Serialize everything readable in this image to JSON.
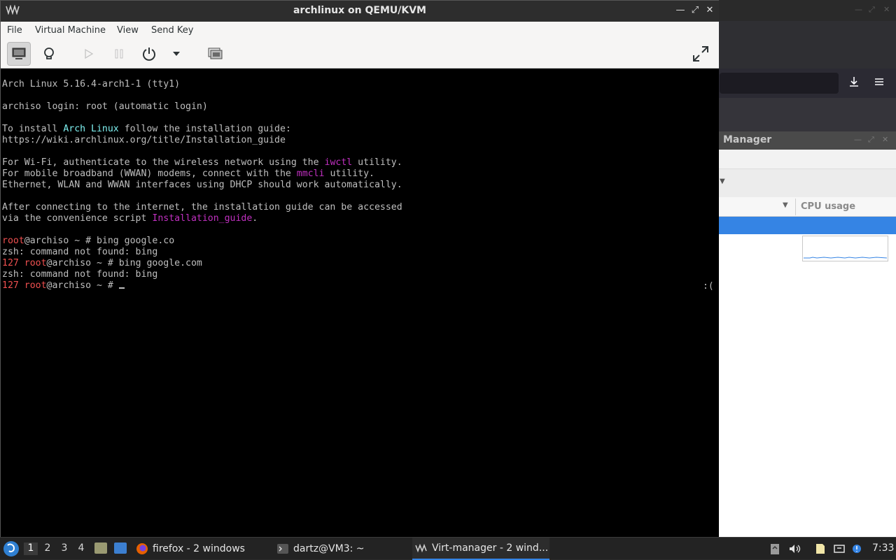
{
  "main_window": {
    "title": "archlinux on QEMU/KVM",
    "menu": [
      "File",
      "Virtual Machine",
      "View",
      "Send Key"
    ]
  },
  "console_lines": [
    {
      "parts": [
        {
          "t": "Arch Linux 5.16.4-arch1-1 (tty1)",
          "c": ""
        }
      ]
    },
    {
      "parts": [
        {
          "t": "archiso login: root (automatic login)",
          "c": ""
        }
      ]
    },
    {
      "parts": [
        {
          "t": "To install ",
          "c": ""
        },
        {
          "t": "Arch Linux",
          "c": "cyan"
        },
        {
          "t": " follow the installation guide:",
          "c": ""
        }
      ]
    },
    {
      "parts": [
        {
          "t": "https://wiki.archlinux.org/title/Installation_guide",
          "c": ""
        }
      ]
    },
    {
      "parts": [
        {
          "t": "For Wi-Fi, authenticate to the wireless network using the ",
          "c": ""
        },
        {
          "t": "iwctl",
          "c": "magenta"
        },
        {
          "t": " utility.",
          "c": ""
        }
      ]
    },
    {
      "parts": [
        {
          "t": "For mobile broadband (WWAN) modems, connect with the ",
          "c": ""
        },
        {
          "t": "mmcli",
          "c": "magenta"
        },
        {
          "t": " utility.",
          "c": ""
        }
      ]
    },
    {
      "parts": [
        {
          "t": "Ethernet, WLAN and WWAN interfaces using DHCP should work automatically.",
          "c": ""
        }
      ]
    },
    {
      "parts": [
        {
          "t": "After connecting to the internet, the installation guide can be accessed",
          "c": ""
        }
      ]
    },
    {
      "parts": [
        {
          "t": "via the convenience script ",
          "c": ""
        },
        {
          "t": "Installation_guide",
          "c": "magenta"
        },
        {
          "t": ".",
          "c": ""
        }
      ]
    },
    {
      "parts": [
        {
          "t": "root",
          "c": "red"
        },
        {
          "t": "@archiso ~ # bing google.co",
          "c": ""
        }
      ]
    },
    {
      "parts": [
        {
          "t": "zsh: command not found: bing",
          "c": ""
        }
      ]
    },
    {
      "parts": [
        {
          "t": "127 ",
          "c": "red"
        },
        {
          "t": "root",
          "c": "red"
        },
        {
          "t": "@archiso ~ # bing google.com",
          "c": ""
        }
      ]
    },
    {
      "parts": [
        {
          "t": "zsh: command not found: bing",
          "c": ""
        }
      ]
    },
    {
      "parts": [
        {
          "t": "127 ",
          "c": "red"
        },
        {
          "t": "root",
          "c": "red"
        },
        {
          "t": "@archiso ~ # ",
          "c": ""
        }
      ],
      "cursor": true
    }
  ],
  "console_right_status": ":(",
  "background_manager": {
    "title": "Manager",
    "column_header": "CPU usage"
  },
  "taskbar": {
    "workspaces": [
      "1",
      "2",
      "3",
      "4"
    ],
    "active_workspace": "1",
    "tasks": [
      {
        "label": "firefox - 2 windows",
        "icon": "firefox-icon"
      },
      {
        "label": "dartz@VM3: ~",
        "icon": "terminal-icon"
      },
      {
        "label": "Virt-manager - 2 wind...",
        "icon": "virt-manager-icon"
      }
    ],
    "clock": "7:33"
  },
  "colors": {
    "accent": "#3584e4",
    "term_cyan": "#7ef0f0",
    "term_magenta": "#c030c0",
    "term_red": "#f05050"
  }
}
